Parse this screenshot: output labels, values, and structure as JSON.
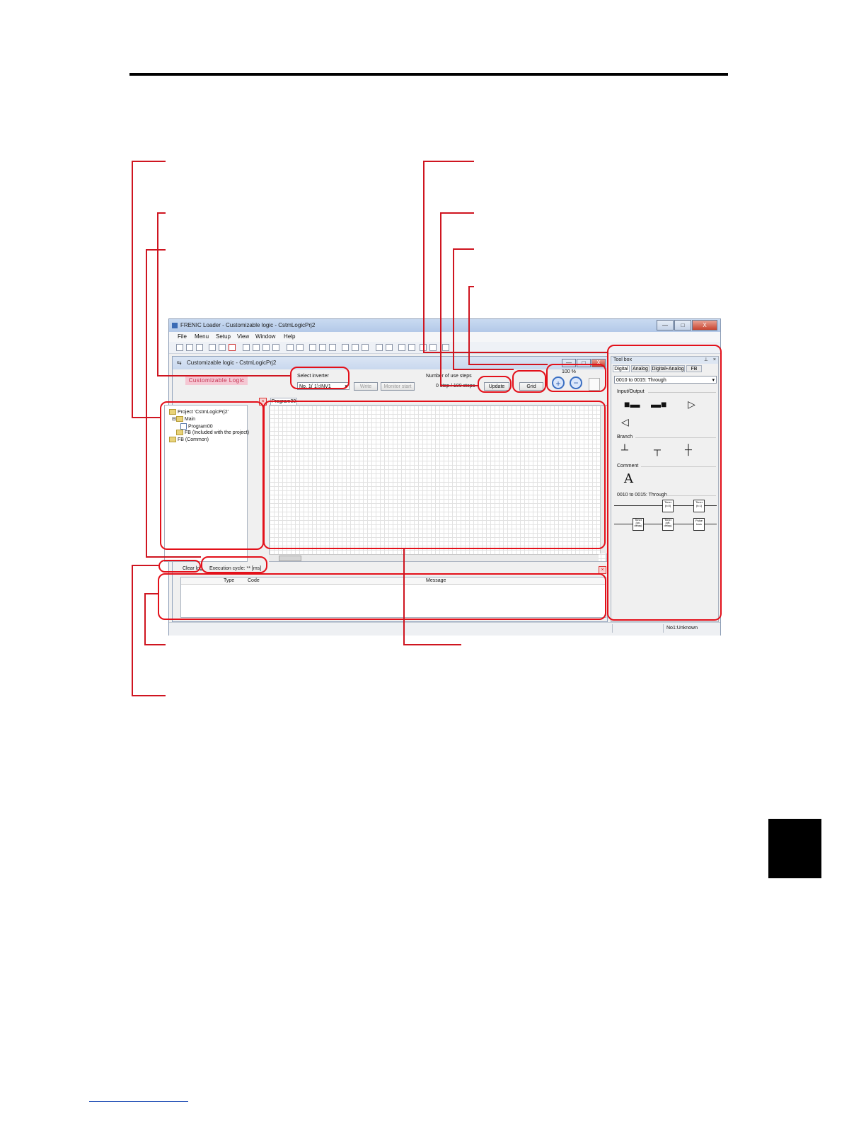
{
  "app": {
    "window_title": "FRENIC Loader - Customizable logic - CstmLogicPrj2",
    "min": "—",
    "max": "□",
    "close": "X"
  },
  "menu": [
    "File",
    "Menu",
    "Setup",
    "View",
    "Window",
    "Help"
  ],
  "child": {
    "title": "Customizable logic - CstmLogicPrj2",
    "banner": "Customizable Logic",
    "select_inverter_label": "Select inverter",
    "select_inverter_value": "No. 1( 1):INV1",
    "write_button": "Write",
    "monitor_button": "Monitor start",
    "steps_label": "Number of use steps",
    "steps_value": "0 step / 100 steps",
    "update_button": "Update",
    "grid_button": "Grid",
    "zoom_value": "100 %",
    "program_tab": "Program00",
    "tree": {
      "project": "Project 'CstmLogicPrj2'",
      "main": "Main",
      "program": "Program00",
      "fb_included": "FB (Included with the project)",
      "fb_common": "FB (Common)"
    },
    "clear_log": "Clear log",
    "exec_cycle": "Execution cycle: ** [ms]",
    "log_columns": {
      "type": "Type",
      "code": "Code",
      "message": "Message"
    }
  },
  "status": {
    "inverter": "No1:Unknown"
  },
  "toolbox": {
    "title": "Tool box",
    "tabs": [
      "Digital",
      "Analog",
      "Digital+Analog",
      "FB"
    ],
    "combo": "0010 to 0015: Through",
    "sections": {
      "io": "Input/Output",
      "branch": "Branch",
      "comment": "Comment",
      "through": "0010 to 0015: Through"
    },
    "comment_symbol": "A",
    "timer_labels": [
      "Timer\n(t=0)",
      "Timer\n(t=1)",
      "Timer\n(on-\ndelay)",
      "Timer\n(off-\ndelay)",
      "Pulse\ntrain"
    ]
  },
  "colors": {
    "annotation": "#e3101a",
    "banner_bg": "#f5c7d3",
    "banner_text": "#c4304f",
    "section_tab": "#000000"
  }
}
